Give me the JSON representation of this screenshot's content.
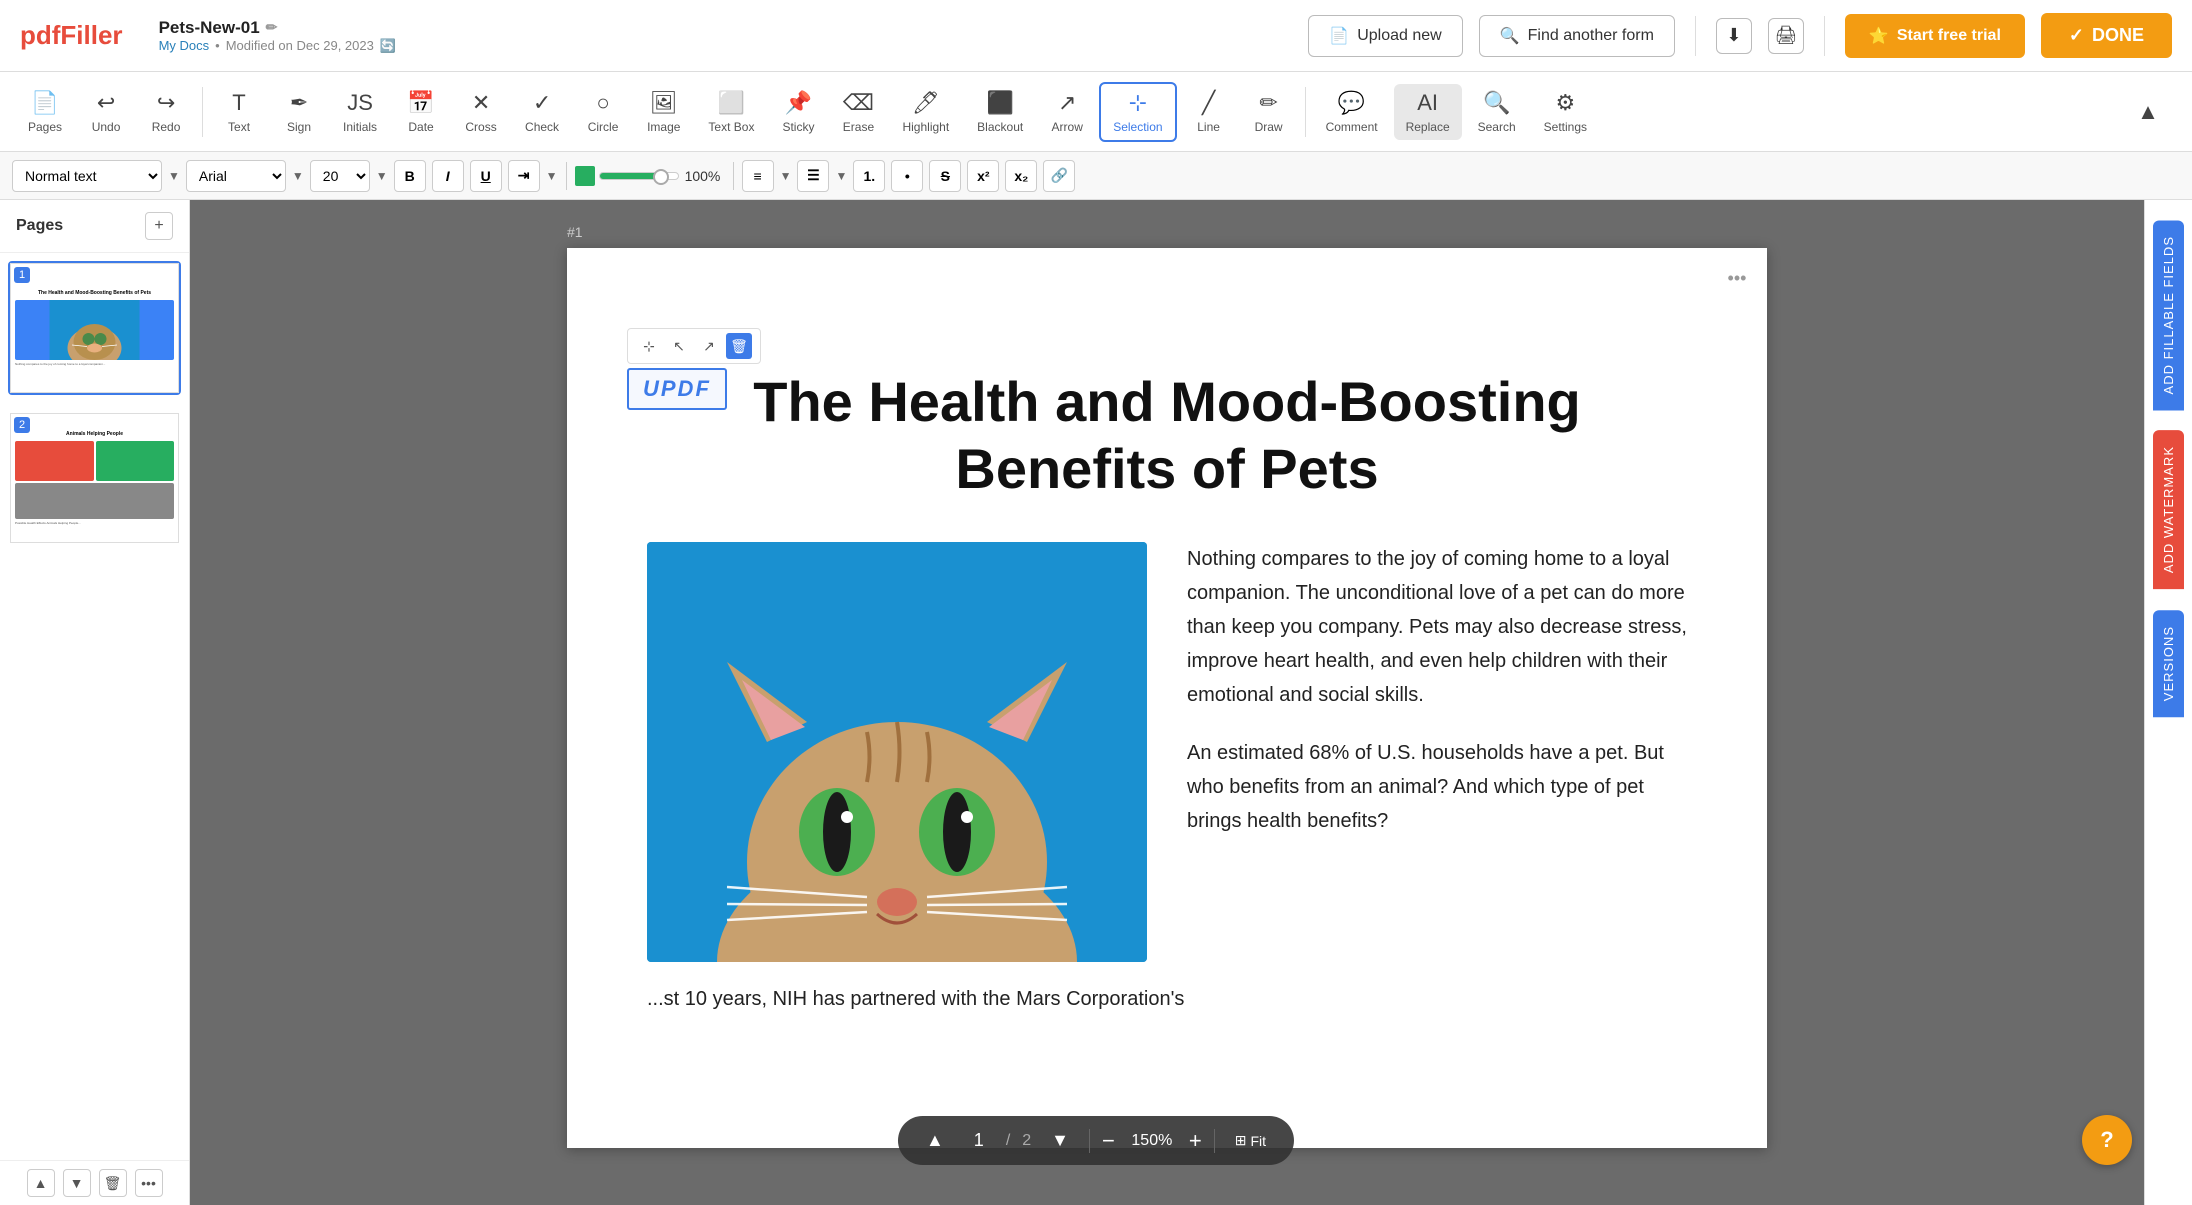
{
  "app": {
    "name": "pdfFiller",
    "logo_pdf": "pdf",
    "logo_filler": "Filler"
  },
  "header": {
    "doc_title": "Pets-New-01",
    "doc_subtitle": "My Docs",
    "doc_modified": "Modified on Dec 29, 2023",
    "upload_new": "Upload new",
    "find_another": "Find another form",
    "download_icon": "⬇",
    "print_icon": "🖨",
    "start_trial": "Start free trial",
    "done": "DONE"
  },
  "toolbar": {
    "pages_label": "Pages",
    "undo_label": "Undo",
    "redo_label": "Redo",
    "text_label": "Text",
    "sign_label": "Sign",
    "initials_label": "Initials",
    "date_label": "Date",
    "cross_label": "Cross",
    "check_label": "Check",
    "circle_label": "Circle",
    "image_label": "Image",
    "textbox_label": "Text Box",
    "sticky_label": "Sticky",
    "erase_label": "Erase",
    "highlight_label": "Highlight",
    "blackout_label": "Blackout",
    "arrow_label": "Arrow",
    "selection_label": "Selection",
    "line_label": "Line",
    "draw_label": "Draw",
    "comment_label": "Comment",
    "replace_label": "Replace",
    "search_label": "Search",
    "settings_label": "Settings",
    "collapse_icon": "▲"
  },
  "format_bar": {
    "text_style": "Normal text",
    "font": "Arial",
    "size": "20",
    "color_percent": "100%",
    "align_icon": "≡",
    "list_icon": "☰"
  },
  "sidebar": {
    "title": "Pages",
    "page1_num": "1",
    "page2_num": "2",
    "page1_thumb_title": "The Health and Mood-Boosting Benefits of Pets",
    "page2_thumb_title": "Animals Helping People"
  },
  "document": {
    "page_label": "#1",
    "title_line1": "The Health and Mood-Boosting",
    "title_line2": "Benefits of Pets",
    "stamp_text": "UPDF",
    "para1": "Nothing compares to the joy of coming home to a loyal companion. The unconditional love of a pet can do more than keep you company. Pets may also decrease stress, improve heart health,  and  even  help children  with  their emotional and social skills.",
    "para2": "An estimated 68% of U.S. households have a pet. But who benefits from an animal? And which type of pet brings health benefits?",
    "para3": "...st 10 years, NIH has partnered with the Mars Corporation's"
  },
  "bottom_nav": {
    "page_current": "1",
    "page_total": "2",
    "zoom": "150%",
    "fit_label": "Fit",
    "fit_icon": "⊞"
  },
  "right_panel": {
    "fields_tab": "ADD FILLABLE FIELDS",
    "watermark_tab": "ADD WATERMARK",
    "versions_tab": "VERSIONS"
  },
  "help": {
    "label": "?"
  }
}
